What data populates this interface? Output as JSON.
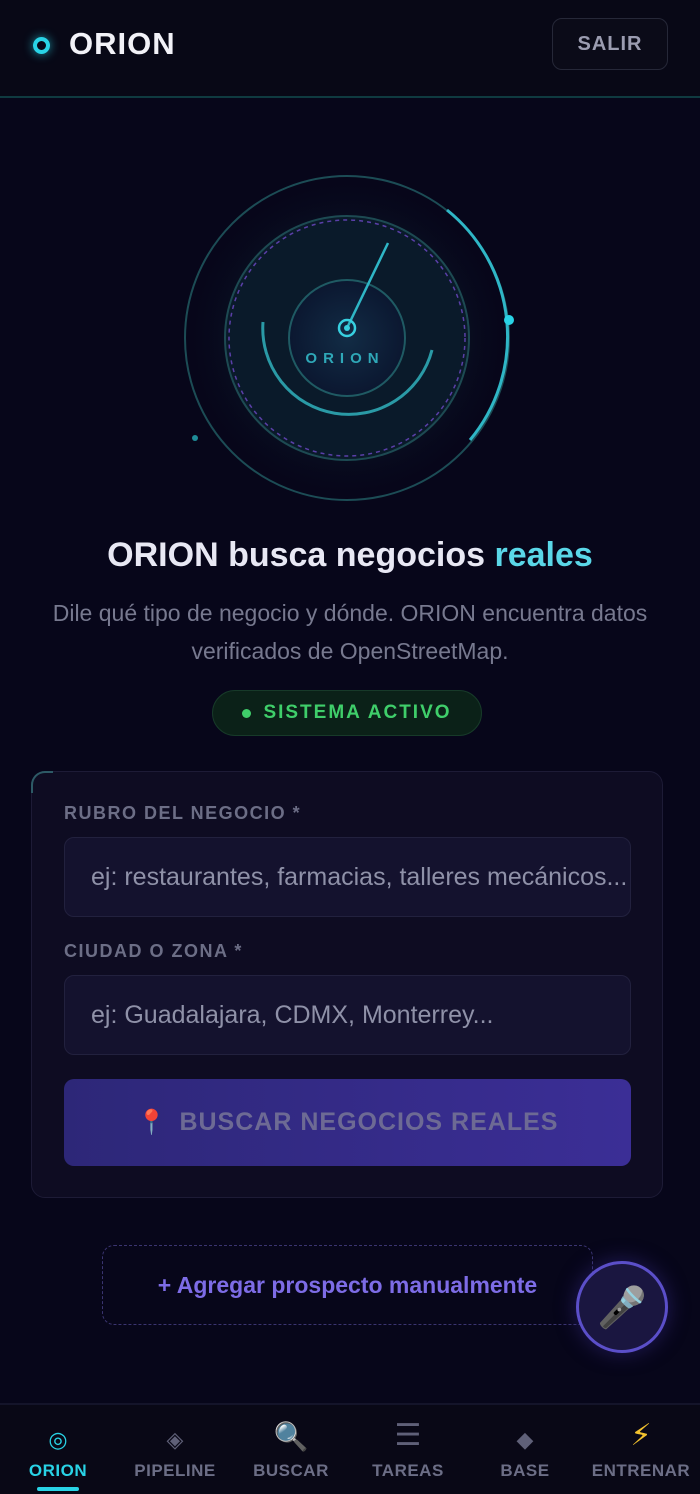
{
  "header": {
    "brand": "ORION",
    "logout_label": "SALIR"
  },
  "radar": {
    "center_label": "ORION"
  },
  "hero": {
    "headline_part1": "ORION busca negocios",
    "headline_highlight": "reales",
    "subtitle": "Dile qué tipo de negocio y dónde. ORION encuentra datos verificados de OpenStreetMap.",
    "status": "SISTEMA ACTIVO"
  },
  "form": {
    "business_label": "RUBRO DEL NEGOCIO *",
    "business_placeholder": "ej: restaurantes, farmacias, talleres mecánicos...",
    "business_value": "",
    "city_label": "CIUDAD O ZONA *",
    "city_placeholder": "ej: Guadalajara, CDMX, Monterrey...",
    "city_value": "",
    "search_icon": "📍",
    "search_label": "BUSCAR NEGOCIOS REALES"
  },
  "manual_add_label": "+ Agregar prospecto manualmente",
  "mic_icon": "🎤",
  "nav": {
    "items": [
      {
        "icon": "◎",
        "label": "ORION",
        "active": true
      },
      {
        "icon": "◈",
        "label": "PIPELINE",
        "active": false
      },
      {
        "icon": "🔍",
        "label": "BUSCAR",
        "active": false
      },
      {
        "icon": "☰",
        "label": "TAREAS",
        "active": false
      },
      {
        "icon": "◆",
        "label": "BASE",
        "active": false
      },
      {
        "icon": "⚡",
        "label": "ENTRENAR",
        "active": false
      }
    ]
  },
  "colors": {
    "accent_cyan": "#29d3e6",
    "accent_purple": "#3b2e96",
    "status_green": "#3fce6a",
    "background": "#07061a"
  }
}
